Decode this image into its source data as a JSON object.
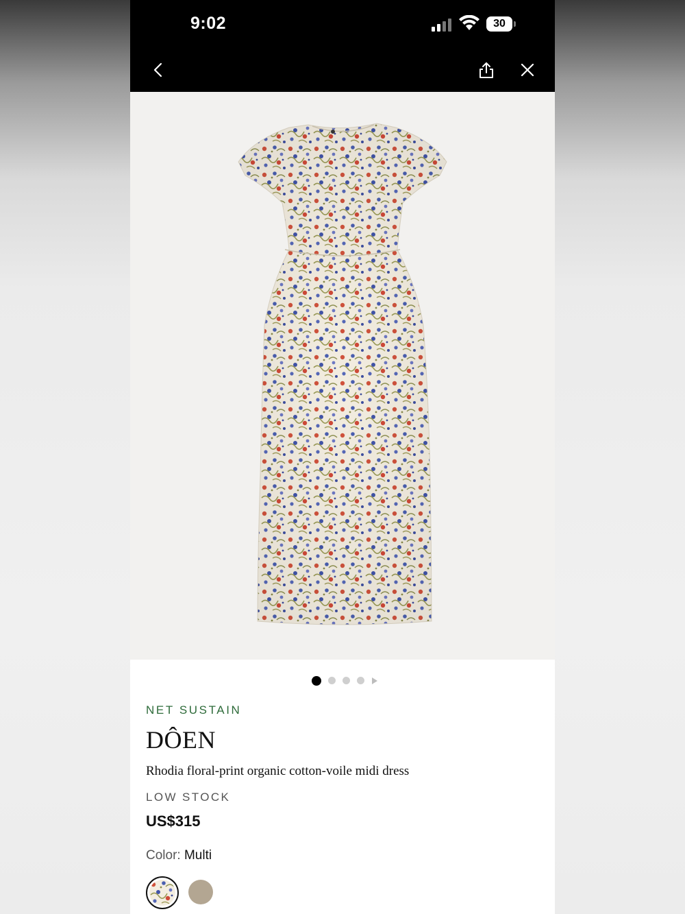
{
  "status_bar": {
    "time": "9:02",
    "battery": "30"
  },
  "nav": {
    "back_icon": "chevron-left-icon",
    "share_icon": "share-icon",
    "close_icon": "close-icon"
  },
  "gallery": {
    "image_count": 4,
    "active_index": 0,
    "has_more_arrow": true
  },
  "product": {
    "eco_tag": "NET SUSTAIN",
    "brand": "DÔEN",
    "name": "Rhodia floral-print organic cotton-voile midi dress",
    "stock_status": "LOW STOCK",
    "price": "US$315",
    "color_label": "Color:",
    "color_value": "Multi"
  },
  "swatches": [
    {
      "name": "Multi",
      "selected": true,
      "color": "#e9e4d6"
    },
    {
      "name": "",
      "selected": false,
      "color": "#b3a692"
    }
  ],
  "colors": {
    "eco_green": "#2e6b3a",
    "bar_black": "#000000",
    "hero_bg": "#f2f1ef"
  }
}
